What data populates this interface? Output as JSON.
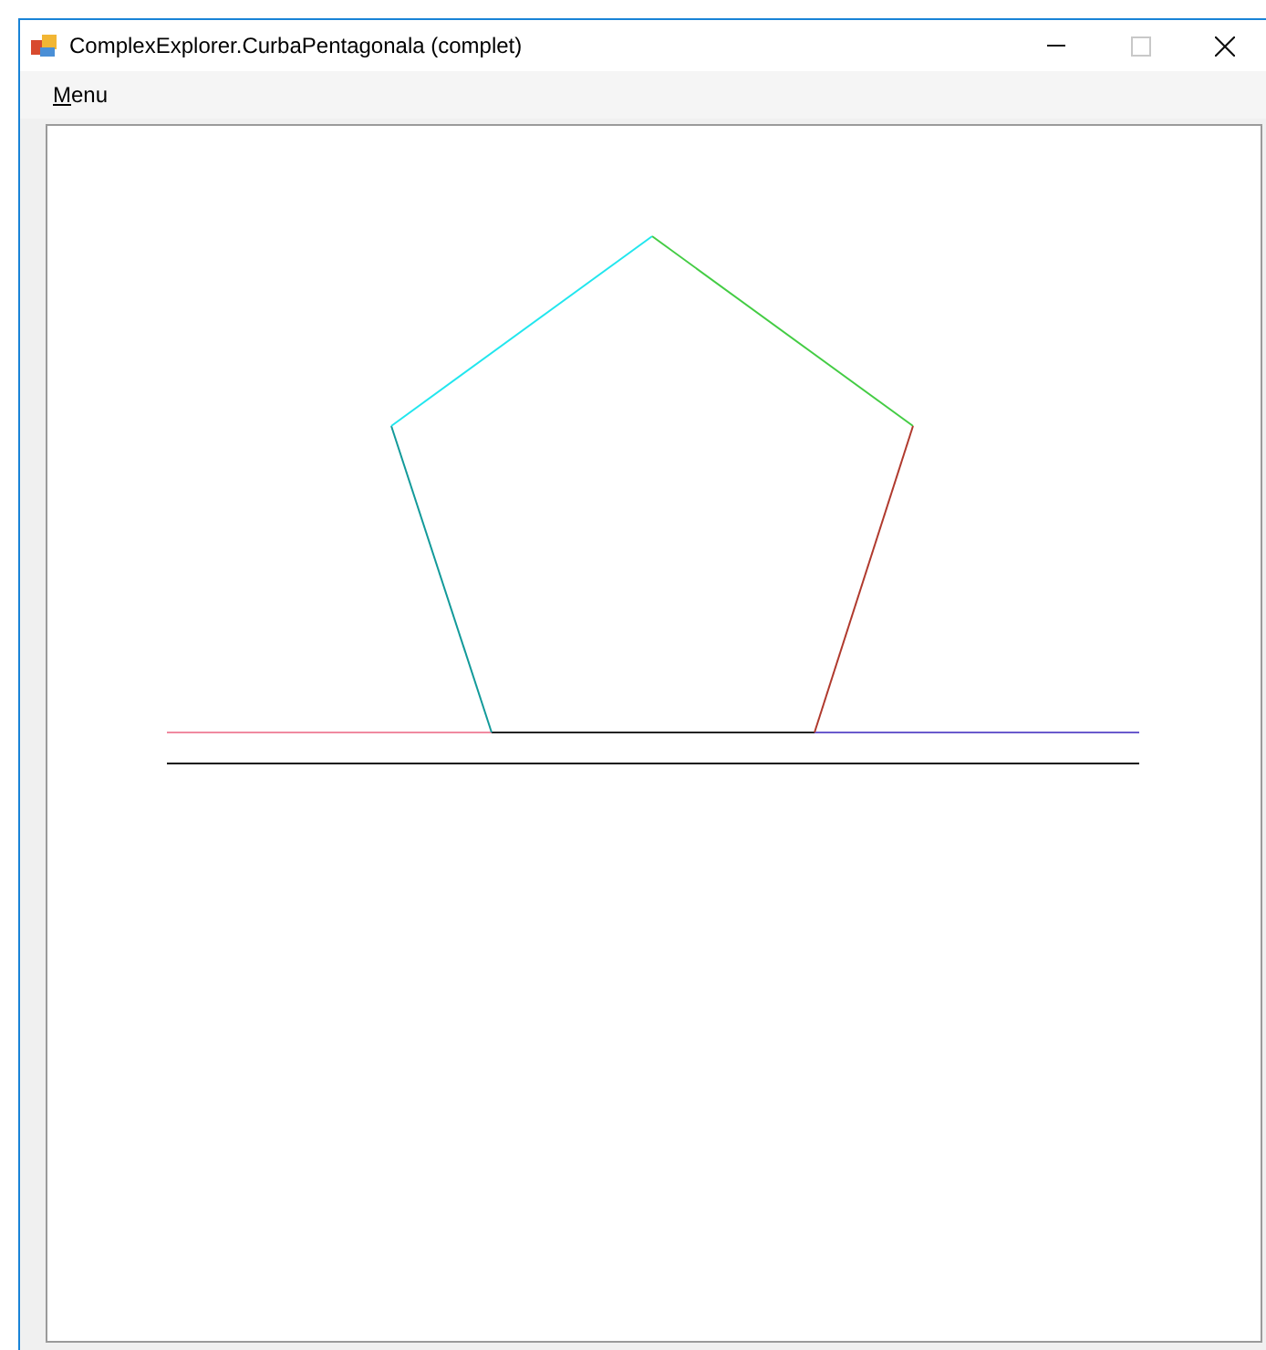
{
  "window": {
    "title": "ComplexExplorer.CurbaPentagonala (complet)"
  },
  "menu_bar": {
    "items": [
      {
        "label": "Menu"
      }
    ]
  }
}
